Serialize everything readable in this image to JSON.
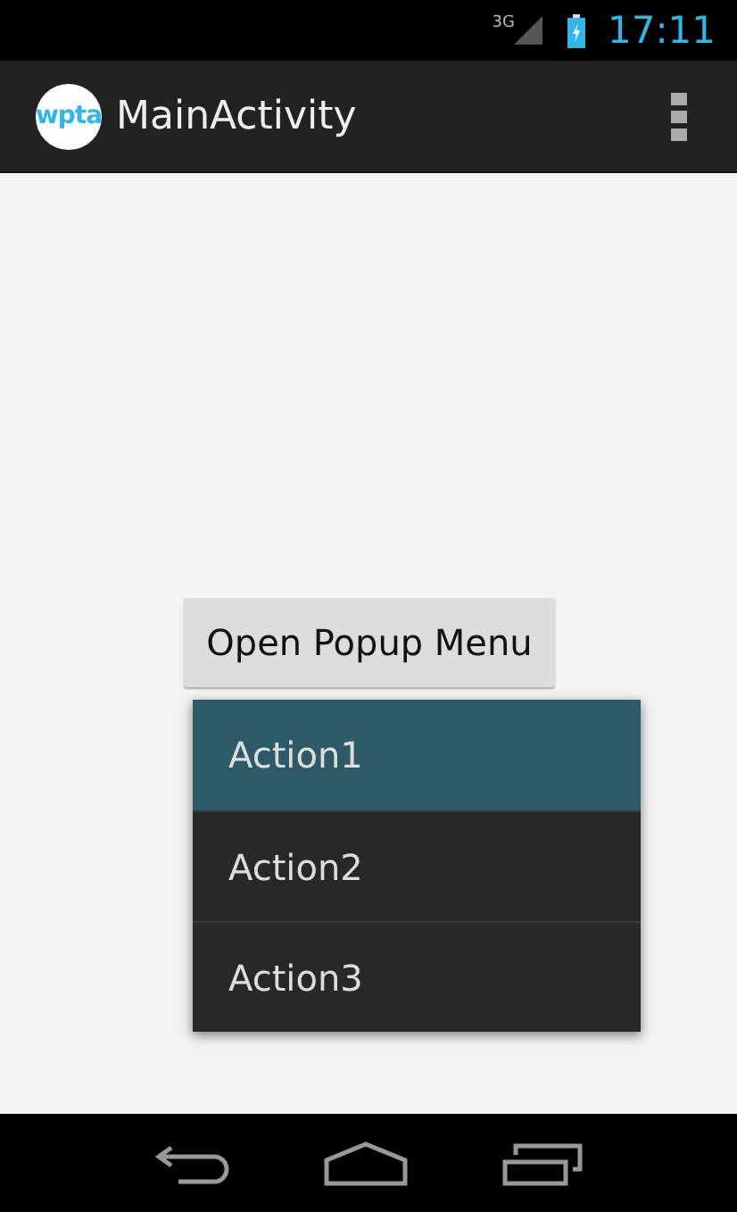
{
  "status_bar": {
    "network": "3G",
    "time": "17:11"
  },
  "action_bar": {
    "logo": "wpta",
    "title": "MainActivity"
  },
  "button": {
    "label": "Open Popup Menu"
  },
  "popup_menu": {
    "items": [
      {
        "label": "Action1",
        "selected": true
      },
      {
        "label": "Action2",
        "selected": false
      },
      {
        "label": "Action3",
        "selected": false
      }
    ]
  }
}
